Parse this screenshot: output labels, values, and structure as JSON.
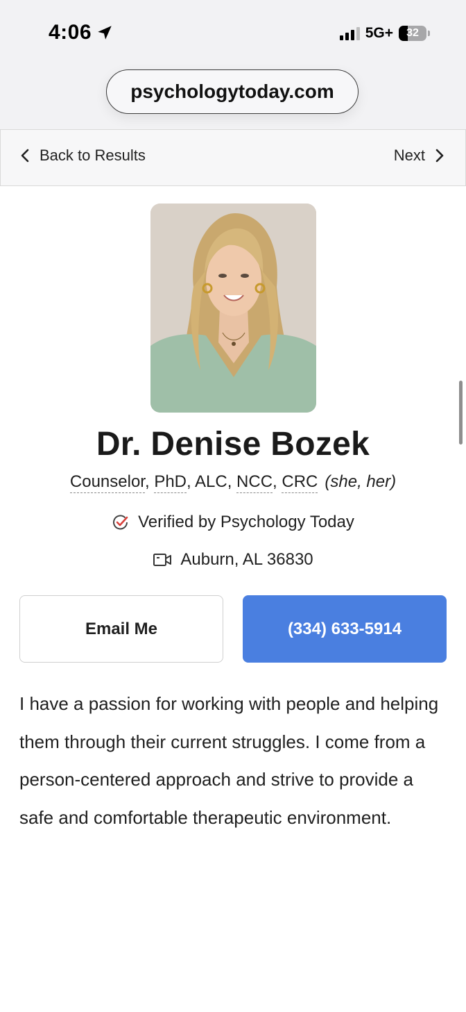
{
  "status_bar": {
    "time": "4:06",
    "network": "5G+",
    "battery": "32"
  },
  "browser": {
    "url": "psychologytoday.com"
  },
  "results_nav": {
    "back_label": "Back to Results",
    "next_label": "Next"
  },
  "profile": {
    "name": "Dr. Denise Bozek",
    "credentials": [
      "Counselor",
      "PhD",
      "ALC",
      "NCC",
      "CRC"
    ],
    "pronouns": "(she, her)",
    "verified_text": "Verified by Psychology Today",
    "location": "Auburn, AL 36830"
  },
  "actions": {
    "email_label": "Email Me",
    "phone_label": "(334) 633-5914"
  },
  "about": {
    "text": "I have a passion for working with people and helping them through their current struggles. I come from a person-centered approach and strive to provide a safe and comfortable therapeutic environment."
  },
  "colors": {
    "accent": "#4a7fe0",
    "verified_check": "#d9403a"
  },
  "icons": {
    "location_arrow": "location-arrow-icon",
    "back": "chevron-left-icon",
    "next": "chevron-right-icon",
    "verified": "verified-check-icon",
    "video": "video-camera-icon"
  }
}
